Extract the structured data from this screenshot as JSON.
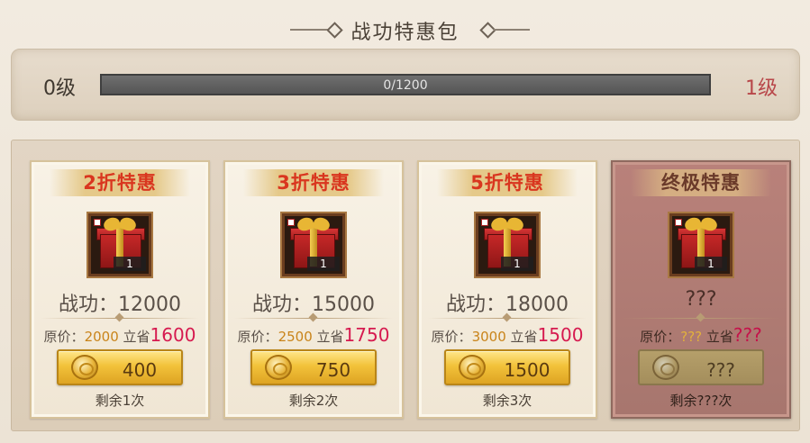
{
  "header": {
    "title": "战功特惠包"
  },
  "progress": {
    "current_level": "0级",
    "next_level": "1级",
    "text": "0/1200",
    "fraction": 0
  },
  "cards": [
    {
      "title": "2折特惠",
      "item_count": "1",
      "merit": "战功：12000",
      "orig_label": "原价：",
      "orig_price": "2000",
      "save_label": "立省",
      "save_amount": "1600",
      "price": "400",
      "remaining": "剩余1次",
      "locked": false
    },
    {
      "title": "3折特惠",
      "item_count": "1",
      "merit": "战功：15000",
      "orig_label": "原价：",
      "orig_price": "2500",
      "save_label": "立省",
      "save_amount": "1750",
      "price": "750",
      "remaining": "剩余2次",
      "locked": false
    },
    {
      "title": "5折特惠",
      "item_count": "1",
      "merit": "战功：18000",
      "orig_label": "原价：",
      "orig_price": "3000",
      "save_label": "立省",
      "save_amount": "1500",
      "price": "1500",
      "remaining": "剩余3次",
      "locked": false
    },
    {
      "title": "终极特惠",
      "item_count": "1",
      "merit": "???",
      "orig_label": "原价：",
      "orig_price": "???",
      "save_label": "立省",
      "save_amount": "???",
      "price": "???",
      "remaining": "剩余???次",
      "locked": true
    }
  ],
  "icons": {
    "item": "gift-box-icon",
    "currency": "gold-coin-icon"
  },
  "colors": {
    "accent_gold": "#f2c23a",
    "title_red": "#d9361f",
    "save_pink": "#d61a4f",
    "next_level": "#b8474a"
  }
}
